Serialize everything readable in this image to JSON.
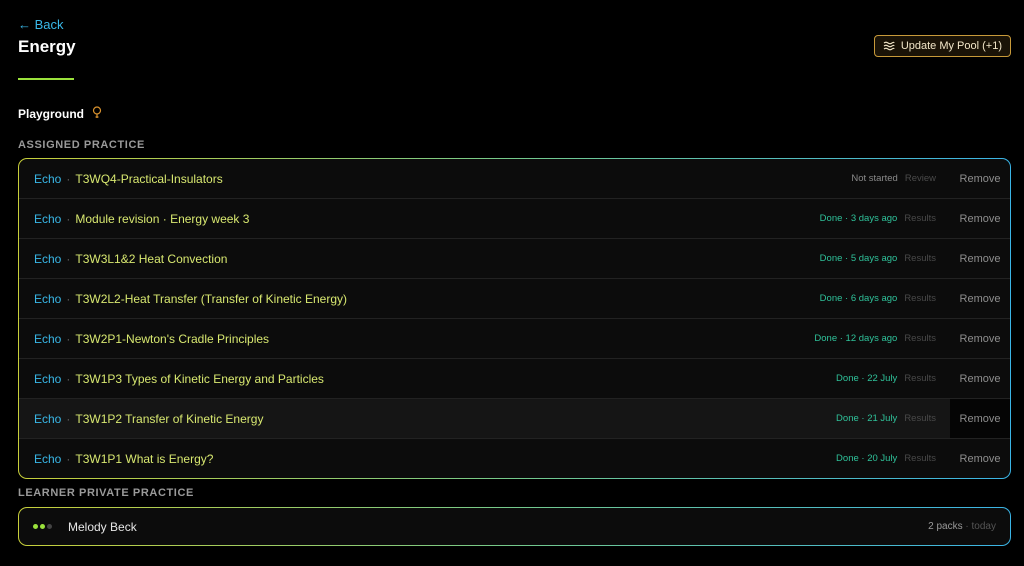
{
  "header": {
    "back_label": "← Back",
    "title": "Energy",
    "update_button_label": "Update My Pool (+1)",
    "accent": "#9be23c"
  },
  "playground": {
    "label": "Playground",
    "icon": "lightbulb-icon"
  },
  "assigned": {
    "section_label": "ASSIGNED PRACTICE",
    "rows": [
      {
        "prefix": "Echo",
        "sep": "·",
        "name": "T3WQ4-Practical-Insulators",
        "status": "Not started",
        "status_type": "not",
        "action": "Review",
        "remove": "Remove"
      },
      {
        "prefix": "Echo",
        "sep": "·",
        "name": "Module revision · Energy week 3",
        "status": "Done · 3 days ago",
        "status_type": "done",
        "action": "Results",
        "remove": "Remove"
      },
      {
        "prefix": "Echo",
        "sep": "·",
        "name": "T3W3L1&2 Heat Convection",
        "status": "Done · 5 days ago",
        "status_type": "done",
        "action": "Results",
        "remove": "Remove"
      },
      {
        "prefix": "Echo",
        "sep": "·",
        "name": "T3W2L2-Heat Transfer (Transfer of Kinetic Energy)",
        "status": "Done · 6 days ago",
        "status_type": "done",
        "action": "Results",
        "remove": "Remove"
      },
      {
        "prefix": "Echo",
        "sep": "·",
        "name": "T3W2P1-Newton's Cradle Principles",
        "status": "Done · 12 days ago",
        "status_type": "done",
        "action": "Results",
        "remove": "Remove"
      },
      {
        "prefix": "Echo",
        "sep": "·",
        "name": "T3W1P3 Types of Kinetic Energy and Particles",
        "status": "Done · 22 July",
        "status_type": "done",
        "action": "Results",
        "remove": "Remove"
      },
      {
        "prefix": "Echo",
        "sep": "·",
        "name": "T3W1P2 Transfer of Kinetic Energy",
        "status": "Done · 21 July",
        "status_type": "done",
        "action": "Results",
        "remove": "Remove"
      },
      {
        "prefix": "Echo",
        "sep": "·",
        "name": "T3W1P1 What is Energy?",
        "status": "Done · 20 July",
        "status_type": "done",
        "action": "Results",
        "remove": "Remove"
      }
    ]
  },
  "learner": {
    "section_label": "LEARNER PRIVATE PRACTICE",
    "name": "Melody Beck",
    "packs": "2 packs",
    "sep": "·",
    "when": "today",
    "dot_colors": [
      "#9be23c",
      "#9be23c",
      "#444444"
    ]
  }
}
